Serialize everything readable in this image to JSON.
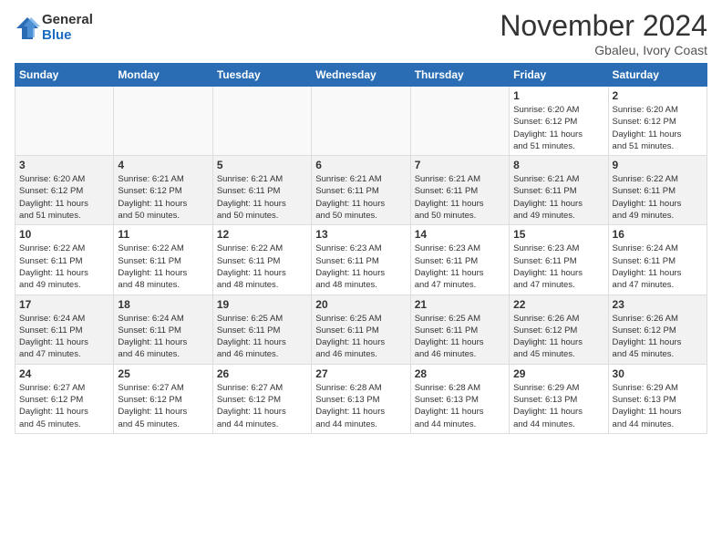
{
  "logo": {
    "general": "General",
    "blue": "Blue"
  },
  "title": "November 2024",
  "location": "Gbaleu, Ivory Coast",
  "headers": [
    "Sunday",
    "Monday",
    "Tuesday",
    "Wednesday",
    "Thursday",
    "Friday",
    "Saturday"
  ],
  "weeks": [
    [
      {
        "day": "",
        "info": ""
      },
      {
        "day": "",
        "info": ""
      },
      {
        "day": "",
        "info": ""
      },
      {
        "day": "",
        "info": ""
      },
      {
        "day": "",
        "info": ""
      },
      {
        "day": "1",
        "info": "Sunrise: 6:20 AM\nSunset: 6:12 PM\nDaylight: 11 hours\nand 51 minutes."
      },
      {
        "day": "2",
        "info": "Sunrise: 6:20 AM\nSunset: 6:12 PM\nDaylight: 11 hours\nand 51 minutes."
      }
    ],
    [
      {
        "day": "3",
        "info": "Sunrise: 6:20 AM\nSunset: 6:12 PM\nDaylight: 11 hours\nand 51 minutes."
      },
      {
        "day": "4",
        "info": "Sunrise: 6:21 AM\nSunset: 6:12 PM\nDaylight: 11 hours\nand 50 minutes."
      },
      {
        "day": "5",
        "info": "Sunrise: 6:21 AM\nSunset: 6:11 PM\nDaylight: 11 hours\nand 50 minutes."
      },
      {
        "day": "6",
        "info": "Sunrise: 6:21 AM\nSunset: 6:11 PM\nDaylight: 11 hours\nand 50 minutes."
      },
      {
        "day": "7",
        "info": "Sunrise: 6:21 AM\nSunset: 6:11 PM\nDaylight: 11 hours\nand 50 minutes."
      },
      {
        "day": "8",
        "info": "Sunrise: 6:21 AM\nSunset: 6:11 PM\nDaylight: 11 hours\nand 49 minutes."
      },
      {
        "day": "9",
        "info": "Sunrise: 6:22 AM\nSunset: 6:11 PM\nDaylight: 11 hours\nand 49 minutes."
      }
    ],
    [
      {
        "day": "10",
        "info": "Sunrise: 6:22 AM\nSunset: 6:11 PM\nDaylight: 11 hours\nand 49 minutes."
      },
      {
        "day": "11",
        "info": "Sunrise: 6:22 AM\nSunset: 6:11 PM\nDaylight: 11 hours\nand 48 minutes."
      },
      {
        "day": "12",
        "info": "Sunrise: 6:22 AM\nSunset: 6:11 PM\nDaylight: 11 hours\nand 48 minutes."
      },
      {
        "day": "13",
        "info": "Sunrise: 6:23 AM\nSunset: 6:11 PM\nDaylight: 11 hours\nand 48 minutes."
      },
      {
        "day": "14",
        "info": "Sunrise: 6:23 AM\nSunset: 6:11 PM\nDaylight: 11 hours\nand 47 minutes."
      },
      {
        "day": "15",
        "info": "Sunrise: 6:23 AM\nSunset: 6:11 PM\nDaylight: 11 hours\nand 47 minutes."
      },
      {
        "day": "16",
        "info": "Sunrise: 6:24 AM\nSunset: 6:11 PM\nDaylight: 11 hours\nand 47 minutes."
      }
    ],
    [
      {
        "day": "17",
        "info": "Sunrise: 6:24 AM\nSunset: 6:11 PM\nDaylight: 11 hours\nand 47 minutes."
      },
      {
        "day": "18",
        "info": "Sunrise: 6:24 AM\nSunset: 6:11 PM\nDaylight: 11 hours\nand 46 minutes."
      },
      {
        "day": "19",
        "info": "Sunrise: 6:25 AM\nSunset: 6:11 PM\nDaylight: 11 hours\nand 46 minutes."
      },
      {
        "day": "20",
        "info": "Sunrise: 6:25 AM\nSunset: 6:11 PM\nDaylight: 11 hours\nand 46 minutes."
      },
      {
        "day": "21",
        "info": "Sunrise: 6:25 AM\nSunset: 6:11 PM\nDaylight: 11 hours\nand 46 minutes."
      },
      {
        "day": "22",
        "info": "Sunrise: 6:26 AM\nSunset: 6:12 PM\nDaylight: 11 hours\nand 45 minutes."
      },
      {
        "day": "23",
        "info": "Sunrise: 6:26 AM\nSunset: 6:12 PM\nDaylight: 11 hours\nand 45 minutes."
      }
    ],
    [
      {
        "day": "24",
        "info": "Sunrise: 6:27 AM\nSunset: 6:12 PM\nDaylight: 11 hours\nand 45 minutes."
      },
      {
        "day": "25",
        "info": "Sunrise: 6:27 AM\nSunset: 6:12 PM\nDaylight: 11 hours\nand 45 minutes."
      },
      {
        "day": "26",
        "info": "Sunrise: 6:27 AM\nSunset: 6:12 PM\nDaylight: 11 hours\nand 44 minutes."
      },
      {
        "day": "27",
        "info": "Sunrise: 6:28 AM\nSunset: 6:13 PM\nDaylight: 11 hours\nand 44 minutes."
      },
      {
        "day": "28",
        "info": "Sunrise: 6:28 AM\nSunset: 6:13 PM\nDaylight: 11 hours\nand 44 minutes."
      },
      {
        "day": "29",
        "info": "Sunrise: 6:29 AM\nSunset: 6:13 PM\nDaylight: 11 hours\nand 44 minutes."
      },
      {
        "day": "30",
        "info": "Sunrise: 6:29 AM\nSunset: 6:13 PM\nDaylight: 11 hours\nand 44 minutes."
      }
    ]
  ]
}
